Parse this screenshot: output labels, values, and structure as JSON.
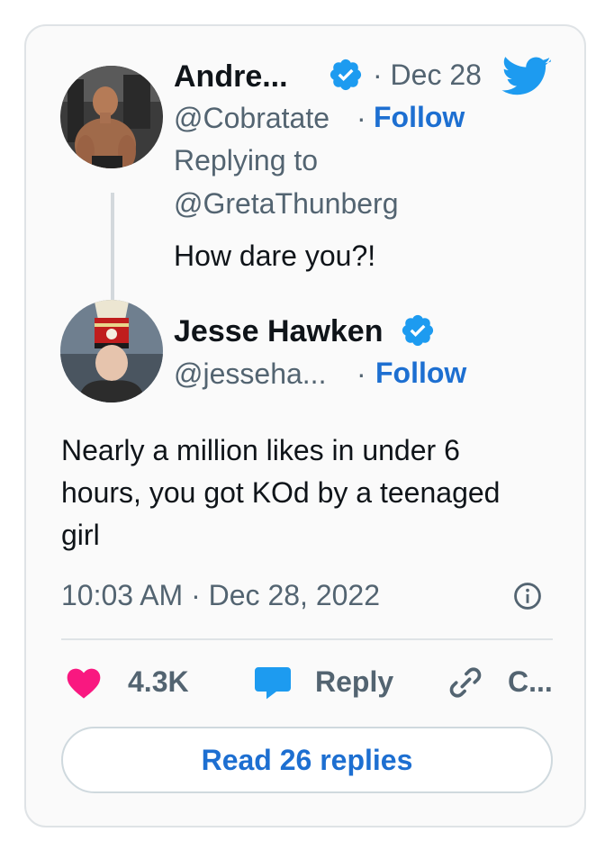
{
  "parent_tweet": {
    "author_name": "Andre...",
    "date": "· Dec 28",
    "handle": "@Cobratate",
    "separator": "·",
    "follow_label": "Follow",
    "replying_to_label": "Replying to",
    "replying_to_handle": "@GretaThunberg",
    "text": "How dare you?!"
  },
  "reply_tweet": {
    "author_name": "Jesse Hawken",
    "handle": "@jesseha...",
    "separator": "·",
    "follow_label": "Follow",
    "text": "Nearly a million likes in under 6 hours, you got KOd by a teenaged girl",
    "timestamp": "10:03 AM · Dec 28, 2022"
  },
  "actions": {
    "like_count": "4.3K",
    "reply_label": "Reply",
    "copy_label": "C..."
  },
  "read_replies_label": "Read 26 replies",
  "colors": {
    "verified": "#1d9bf0",
    "link": "#1d6fd1",
    "heart": "#f91880",
    "twitter_bird": "#1d9bf0",
    "muted_text": "#536471"
  },
  "icons": {
    "logo": "twitter-bird-icon",
    "verified": "verified-badge-icon",
    "info": "info-icon",
    "like": "heart-icon",
    "reply": "speech-bubble-icon",
    "copy": "link-icon"
  }
}
